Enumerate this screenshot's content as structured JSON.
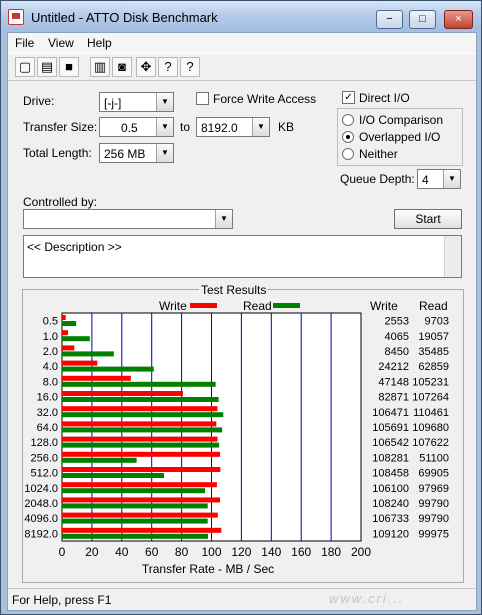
{
  "window": {
    "title": "Untitled - ATTO Disk Benchmark"
  },
  "menu": {
    "items": [
      "File",
      "View",
      "Help"
    ]
  },
  "toolbar": {
    "icons": [
      "new-icon",
      "open-icon",
      "save-icon",
      "print-icon",
      "print-preview-icon",
      "move-icon",
      "help-icon",
      "context-help-icon"
    ]
  },
  "form": {
    "drive_label": "Drive:",
    "drive_value": "[-j-]",
    "force_write_label": "Force Write Access",
    "direct_io_label": "Direct I/O",
    "transfer_size_label": "Transfer Size:",
    "transfer_from": "0.5",
    "to_label": "to",
    "transfer_to": "8192.0",
    "kb_label": "KB",
    "total_length_label": "Total Length:",
    "total_length_value": "256 MB",
    "io_comparison_label": "I/O Comparison",
    "overlapped_io_label": "Overlapped I/O",
    "neither_label": "Neither",
    "queue_depth_label": "Queue Depth:",
    "queue_depth_value": "4",
    "controlled_by_label": "Controlled by:",
    "controlled_by_value": "",
    "start_label": "Start",
    "description_text": "<< Description >>"
  },
  "results": {
    "title": "Test Results",
    "write_legend": "Write",
    "read_legend": "Read",
    "write_header": "Write",
    "read_header": "Read"
  },
  "chart_data": {
    "type": "bar",
    "categories": [
      "0.5",
      "1.0",
      "2.0",
      "4.0",
      "8.0",
      "16.0",
      "32.0",
      "64.0",
      "128.0",
      "256.0",
      "512.0",
      "1024.0",
      "2048.0",
      "4096.0",
      "8192.0"
    ],
    "series": [
      {
        "name": "Write",
        "values": [
          2553,
          4065,
          8450,
          24212,
          47148,
          82871,
          106471,
          105691,
          106542,
          108281,
          108458,
          106100,
          108240,
          106733,
          109120
        ],
        "color": "#ff0000"
      },
      {
        "name": "Read",
        "values": [
          9703,
          19057,
          35485,
          62859,
          105231,
          107264,
          110461,
          109680,
          107622,
          51100,
          69905,
          97969,
          99790,
          99790,
          99975
        ],
        "color": "#008000"
      }
    ],
    "xlabel": "Transfer Rate - MB / Sec",
    "xlim": [
      0,
      200
    ],
    "xticks": [
      "0",
      "20",
      "40",
      "60",
      "80",
      "100",
      "120",
      "140",
      "160",
      "180",
      "200"
    ],
    "grid": true,
    "legend": "top"
  },
  "status": {
    "text": "For Help, press F1"
  }
}
